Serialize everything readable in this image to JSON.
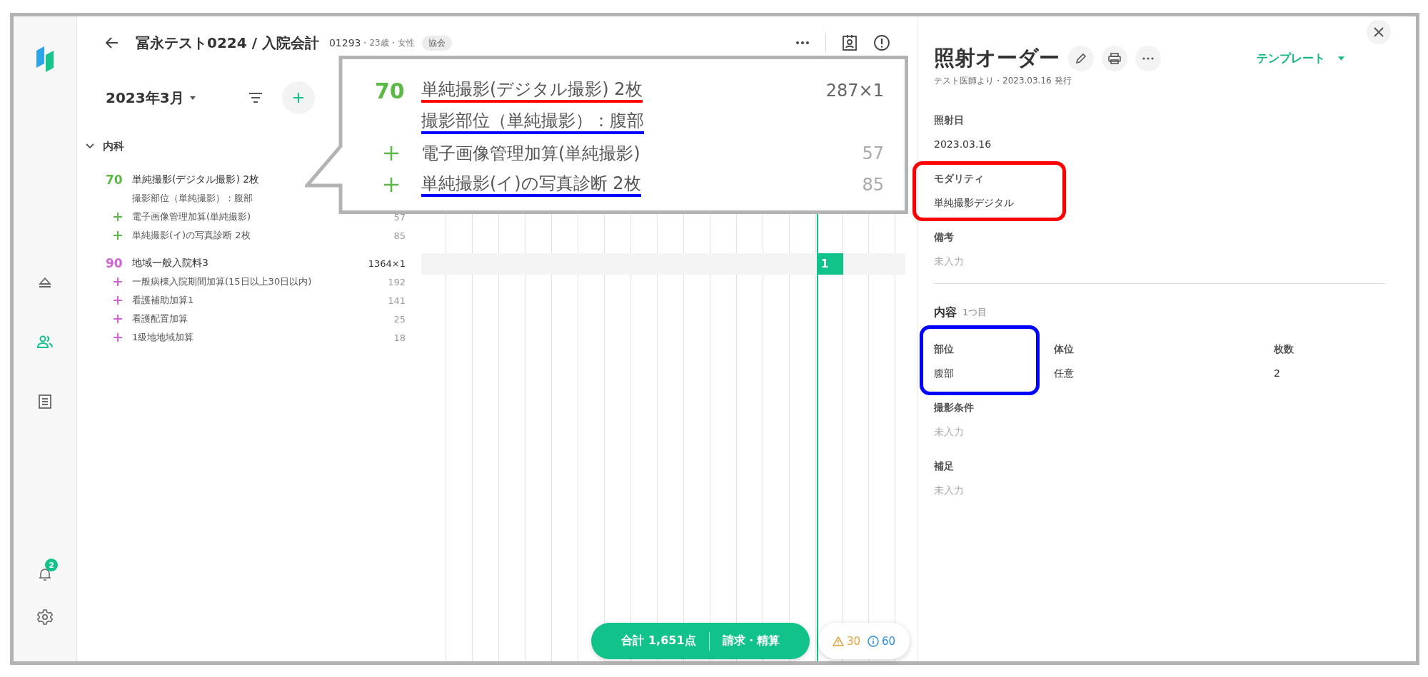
{
  "sidebar": {
    "nav": [
      {
        "kind": "eject",
        "selected": false
      },
      {
        "kind": "people",
        "selected": true
      },
      {
        "kind": "document",
        "selected": false
      }
    ],
    "notifications": "2"
  },
  "header": {
    "title": "冨永テスト0224 / 入院会計",
    "patient_id": "01293",
    "patient_info": "・23歳・女性",
    "badge": "協会"
  },
  "month": "2023年3月",
  "department": {
    "name": "内科",
    "expanded": true,
    "groups": [
      {
        "code": "70",
        "color": "#5cb947",
        "name": "単純撮影(デジタル撮影) 2枚",
        "detail": "撮影部位（単純撮影）：腹部",
        "addons": [
          {
            "name": "電子画像管理加算(単純撮影)",
            "points": "57"
          },
          {
            "name": "単純撮影(イ)の写真診断 2枚",
            "points": "85"
          }
        ]
      },
      {
        "code": "90",
        "color": "#d361d6",
        "name": "地域一般入院料3",
        "points": "1364×1",
        "addons": [
          {
            "name": "一般病棟入院期間加算(15日以上30日以内)",
            "points": "192"
          },
          {
            "name": "看護補助加算1",
            "points": "141"
          },
          {
            "name": "看護配置加算",
            "points": "25"
          },
          {
            "name": "1級地地域加算",
            "points": "18"
          }
        ]
      }
    ]
  },
  "timeline": {
    "marker": "1"
  },
  "summary": {
    "total": "合計 1,651点",
    "checkout_button": "請求・精算",
    "warnings": "30",
    "infos": "60"
  },
  "callout": {
    "code": "70",
    "name": "単純撮影(デジタル撮影) 2枚",
    "color": "#ff0000",
    "points": "287×1",
    "rows": [
      {
        "kind": "detail",
        "text": "撮影部位（単純撮影）：腹部",
        "color": "#0000ff"
      },
      {
        "kind": "addon",
        "text": "電子画像管理加算(単純撮影)",
        "points": "57"
      },
      {
        "kind": "addon",
        "text": "単純撮影(イ)の写真診断 2枚",
        "points": "85",
        "color": "#0000ff"
      }
    ]
  },
  "order_panel": {
    "title": "照射オーダー",
    "subtitle": "テスト医師より・2023.03.16 発行",
    "template_button": "テンプレート",
    "fields": [
      {
        "label": "照射日",
        "value": "2023.03.16",
        "empty": false
      },
      {
        "label": "モダリティ",
        "value": "単純撮影デジタル",
        "empty": false,
        "color": "#ff0000"
      },
      {
        "label": "備考",
        "value": "未入力",
        "empty": true
      }
    ],
    "content": {
      "title": "内容",
      "note": "1つ目",
      "columns": [
        {
          "label": "部位",
          "value": "腹部",
          "color": "#0000ff"
        },
        {
          "label": "体位",
          "value": "任意"
        },
        {
          "label": "枚数",
          "value": "2"
        }
      ],
      "fields": [
        {
          "label": "撮影条件",
          "value": "未入力",
          "empty": true
        },
        {
          "label": "補足",
          "value": "未入力",
          "empty": true
        }
      ]
    }
  }
}
